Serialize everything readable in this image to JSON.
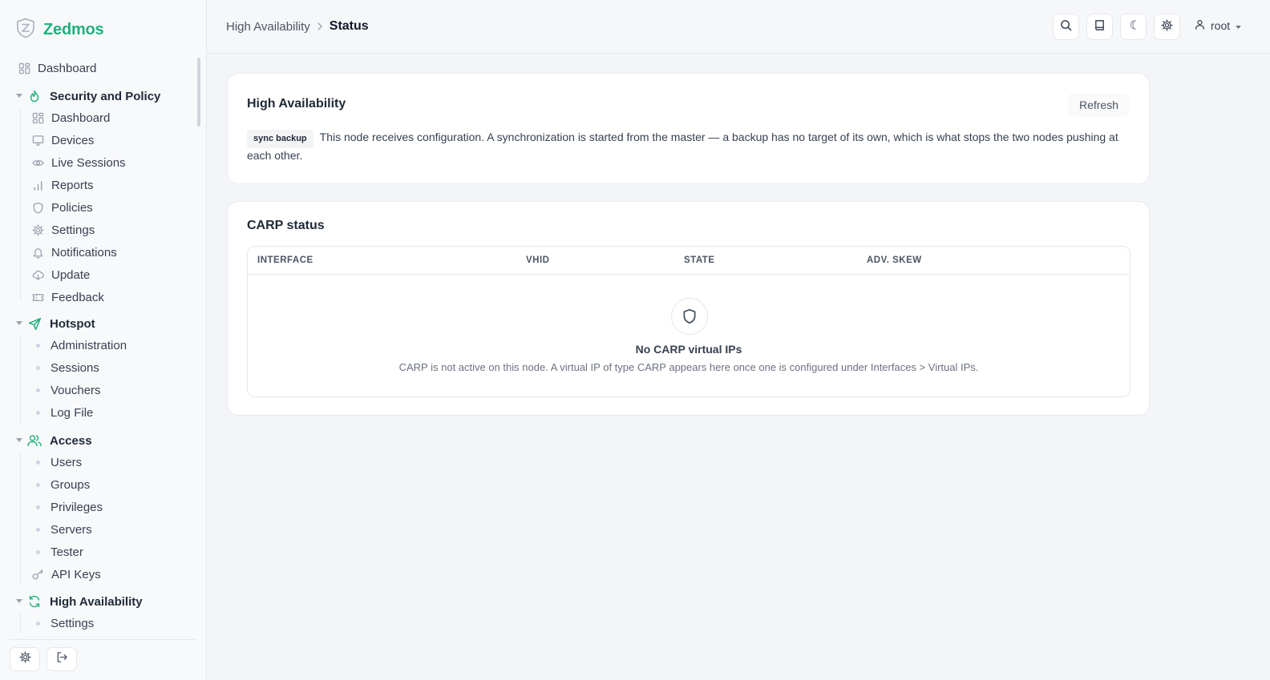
{
  "brand": {
    "name": "Zedmos",
    "accent": "#22b07d"
  },
  "sidebar": {
    "dashboard": "Dashboard",
    "groups": [
      {
        "label": "Security and Policy",
        "icon": "flame-icon",
        "items": [
          {
            "label": "Dashboard",
            "icon": "dashboard-icon"
          },
          {
            "label": "Devices",
            "icon": "monitor-icon"
          },
          {
            "label": "Live Sessions",
            "icon": "eye-icon"
          },
          {
            "label": "Reports",
            "icon": "bar-chart-icon"
          },
          {
            "label": "Policies",
            "icon": "shield-icon"
          },
          {
            "label": "Settings",
            "icon": "gear-icon"
          },
          {
            "label": "Notifications",
            "icon": "bell-icon"
          },
          {
            "label": "Update",
            "icon": "cloud-download-icon"
          },
          {
            "label": "Feedback",
            "icon": "ticket-icon"
          }
        ]
      },
      {
        "label": "Hotspot",
        "icon": "send-icon",
        "items": [
          {
            "label": "Administration"
          },
          {
            "label": "Sessions"
          },
          {
            "label": "Vouchers"
          },
          {
            "label": "Log File"
          }
        ]
      },
      {
        "label": "Access",
        "icon": "users-icon",
        "items": [
          {
            "label": "Users"
          },
          {
            "label": "Groups"
          },
          {
            "label": "Privileges"
          },
          {
            "label": "Servers"
          },
          {
            "label": "Tester"
          },
          {
            "label": "API Keys",
            "icon": "key-icon"
          }
        ]
      },
      {
        "label": "High Availability",
        "icon": "refresh-icon",
        "items": [
          {
            "label": "Settings"
          }
        ]
      }
    ]
  },
  "header": {
    "breadcrumb_parent": "High Availability",
    "breadcrumb_current": "Status",
    "user": "root"
  },
  "ha_card": {
    "title": "High Availability",
    "refresh": "Refresh",
    "badge": "sync backup",
    "description": "This node receives configuration. A synchronization is started from the master — a backup has no target of its own, which is what stops the two nodes pushing at each other."
  },
  "carp_card": {
    "title": "CARP status",
    "columns": [
      "INTERFACE",
      "VHID",
      "STATE",
      "ADV. SKEW"
    ],
    "empty_title": "No CARP virtual IPs",
    "empty_desc": "CARP is not active on this node. A virtual IP of type CARP appears here once one is configured under Interfaces > Virtual IPs."
  }
}
